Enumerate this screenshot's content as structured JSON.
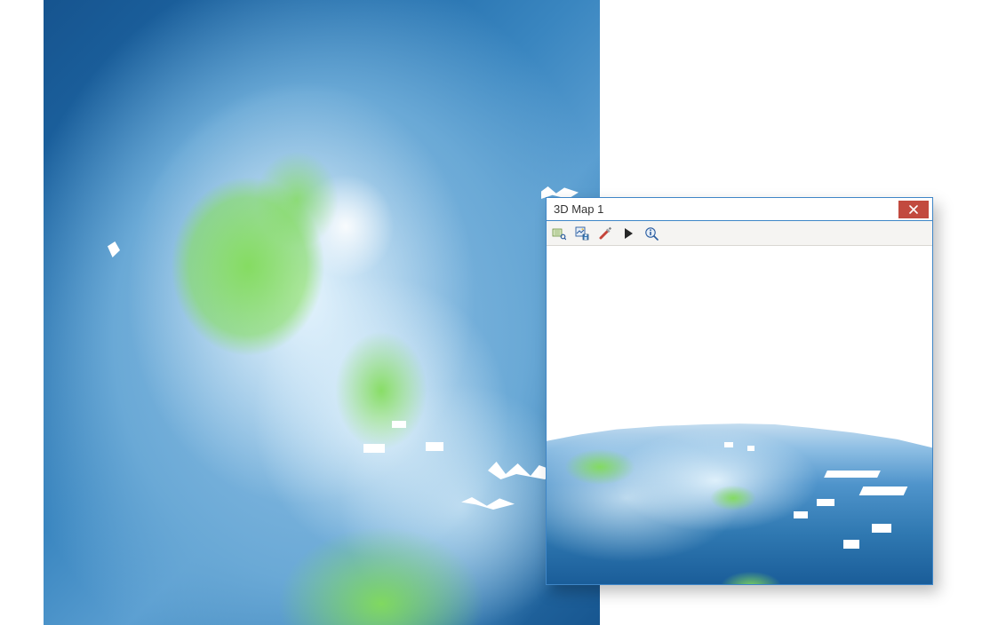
{
  "window": {
    "title": "3D Map 1",
    "close_tooltip": "Close"
  },
  "toolbar": {
    "items": [
      {
        "name": "pan-icon",
        "tooltip": "Pan"
      },
      {
        "name": "save-view-icon",
        "tooltip": "Save View"
      },
      {
        "name": "settings-icon",
        "tooltip": "3D Settings"
      },
      {
        "name": "play-icon",
        "tooltip": "Animate"
      },
      {
        "name": "identify-icon",
        "tooltip": "Identify"
      }
    ]
  },
  "colors": {
    "window_border": "#3f86c7",
    "close_bg": "#c24a3f",
    "toolbar_bg": "#f5f4f2",
    "terrain_low": "#16548f",
    "terrain_mid": "#5a9ed1",
    "terrain_high": "#e9f4fb",
    "vegetation": "#82dc5a"
  }
}
